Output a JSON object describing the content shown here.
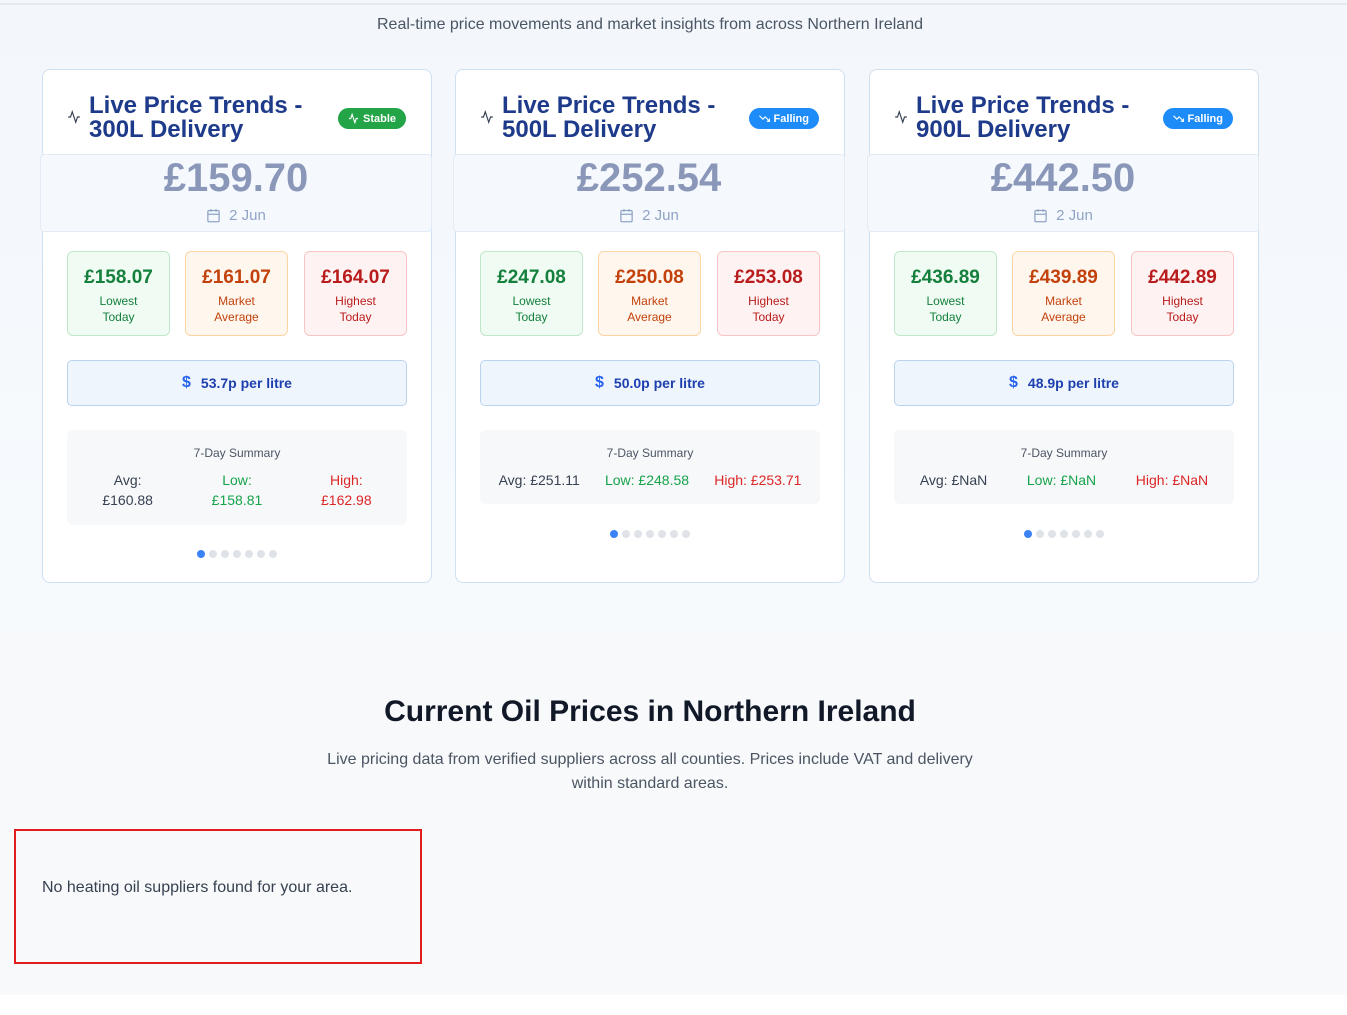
{
  "header": {
    "subtitle": "Real-time price movements and market insights from across Northern Ireland"
  },
  "colors": {
    "title_blue": "#1e3a8a",
    "stable_badge": "#22a447",
    "falling_badge": "#1d8cf8",
    "low_green": "#15803d",
    "avg_orange": "#c2410c",
    "high_red": "#b91c1c",
    "dot_active": "#3b82f6"
  },
  "cards": [
    {
      "title_line1": "Live Price Trends -",
      "title_line2": "300L Delivery",
      "trend_icon": "activity-icon",
      "badge": {
        "label": "Stable",
        "variant": "stable",
        "icon": "activity-icon"
      },
      "price": "£159.70",
      "date": "2 Jun",
      "lowest": {
        "value": "£158.07",
        "label1": "Lowest",
        "label2": "Today"
      },
      "average": {
        "value": "£161.07",
        "label1": "Market",
        "label2": "Average"
      },
      "highest": {
        "value": "£164.07",
        "label1": "Highest",
        "label2": "Today"
      },
      "per_litre": "53.7p per litre",
      "summary": {
        "title": "7-Day Summary",
        "avg_label": "Avg:",
        "avg_value": "£160.88",
        "low_label": "Low:",
        "low_value": "£158.81",
        "high_label": "High:",
        "high_value": "£162.98"
      },
      "dots": 7,
      "active_dot": 0
    },
    {
      "title_line1": "Live Price Trends -",
      "title_line2": "500L Delivery",
      "trend_icon": "activity-icon",
      "badge": {
        "label": "Falling",
        "variant": "falling",
        "icon": "trending-down-icon"
      },
      "price": "£252.54",
      "date": "2 Jun",
      "lowest": {
        "value": "£247.08",
        "label1": "Lowest",
        "label2": "Today"
      },
      "average": {
        "value": "£250.08",
        "label1": "Market",
        "label2": "Average"
      },
      "highest": {
        "value": "£253.08",
        "label1": "Highest",
        "label2": "Today"
      },
      "per_litre": "50.0p per litre",
      "summary": {
        "title": "7-Day Summary",
        "avg": "Avg: £251.11",
        "low": "Low: £248.58",
        "high": "High: £253.71"
      },
      "dots": 7,
      "active_dot": 0
    },
    {
      "title_line1": "Live Price Trends -",
      "title_line2": "900L Delivery",
      "trend_icon": "activity-icon",
      "badge": {
        "label": "Falling",
        "variant": "falling",
        "icon": "trending-down-icon"
      },
      "price": "£442.50",
      "date": "2 Jun",
      "lowest": {
        "value": "£436.89",
        "label1": "Lowest",
        "label2": "Today"
      },
      "average": {
        "value": "£439.89",
        "label1": "Market",
        "label2": "Average"
      },
      "highest": {
        "value": "£442.89",
        "label1": "Highest",
        "label2": "Today"
      },
      "per_litre": "48.9p per litre",
      "summary": {
        "title": "7-Day Summary",
        "avg": "Avg: £NaN",
        "low": "Low: £NaN",
        "high": "High: £NaN"
      },
      "dots": 7,
      "active_dot": 0
    }
  ],
  "section": {
    "title": "Current Oil Prices in Northern Ireland",
    "description": "Live pricing data from verified suppliers across all counties. Prices include VAT and delivery within standard areas."
  },
  "empty_state": {
    "message": "No heating oil suppliers found for your area."
  }
}
